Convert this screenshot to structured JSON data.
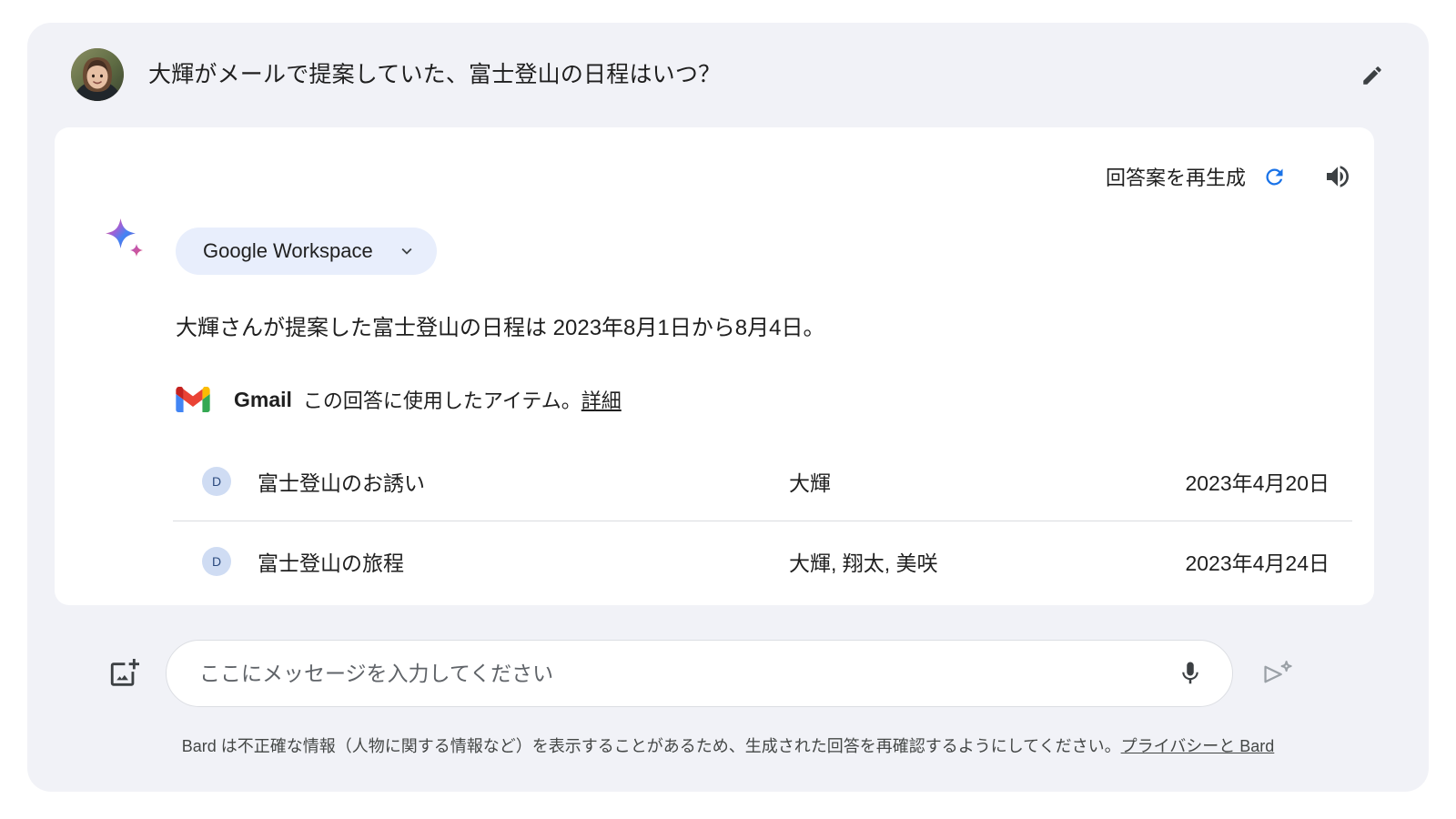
{
  "app": {
    "name": "Bard",
    "accent_blue": "#1a73e8",
    "panel_bg": "#f1f2f7",
    "card_bg": "#ffffff",
    "chip_bg": "#e8eefc",
    "text_color": "#1f1f1f"
  },
  "prompt": {
    "text": "大輝がメールで提案していた、富士登山の日程はいつ？",
    "avatar_alt": "ユーザーのプロフィール写真",
    "edit_icon": "pencil-icon"
  },
  "answer": {
    "toolbar": {
      "regenerate_label": "回答案を再生成",
      "regenerate_icon": "refresh-icon",
      "speaker_icon": "volume-up-icon"
    },
    "bard_icon": "bard-sparkle-icon",
    "extension_chip": {
      "label": "Google Workspace",
      "chevron_icon": "chevron-down-icon"
    },
    "body": "大輝さんが提案した富士登山の日程は 2023年8月1日から8月4日。",
    "source": {
      "icon": "gmail-icon",
      "app": "Gmail",
      "note": "この回答に使用したアイテム。",
      "link": "詳細"
    },
    "results": [
      {
        "avatar_initial": "D",
        "title": "富士登山のお誘い",
        "people": "大輝",
        "date": "2023年4月20日"
      },
      {
        "avatar_initial": "D",
        "title": "富士登山の旅程",
        "people": "大輝, 翔太, 美咲",
        "date": "2023年4月24日"
      }
    ]
  },
  "composer": {
    "image_icon": "add-image-icon",
    "placeholder": "ここにメッセージを入力してください",
    "value": "",
    "mic_icon": "microphone-icon",
    "send_icon": "send-sparkle-icon"
  },
  "footer": {
    "disclaimer": "Bard は不正確な情報（人物に関する情報など）を表示することがあるため、生成された回答を再確認するようにしてください。",
    "link": "プライバシーと Bard"
  }
}
